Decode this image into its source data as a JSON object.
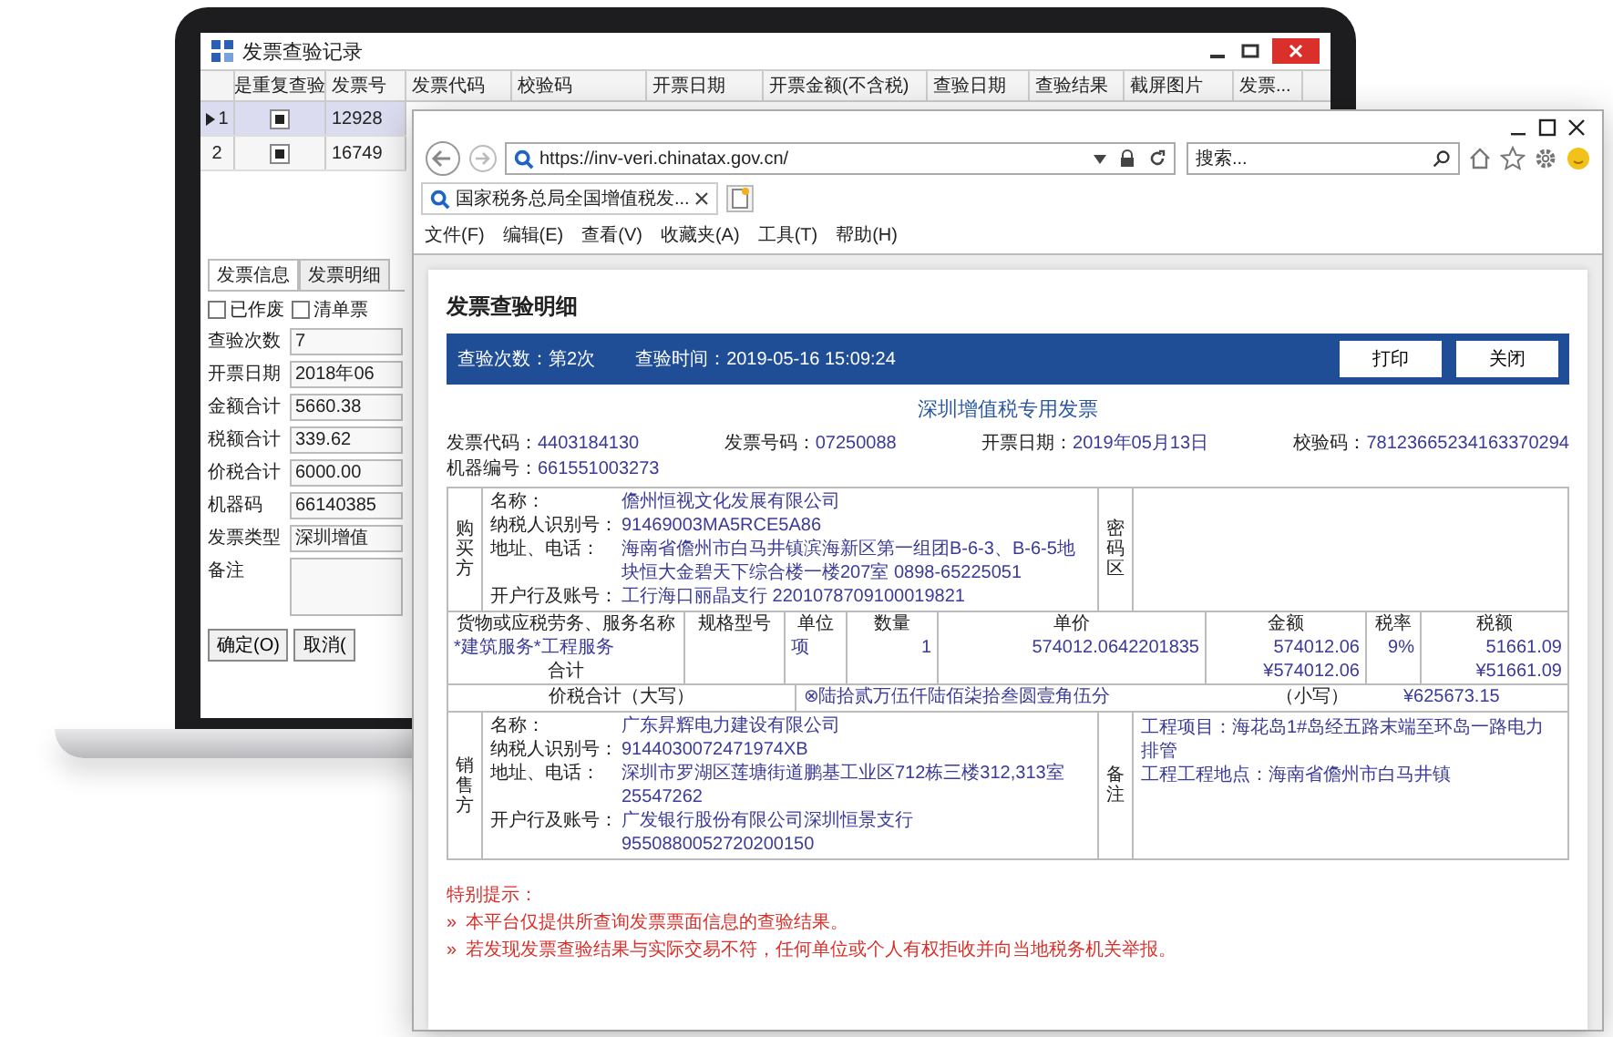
{
  "records_window": {
    "title": "发票查验记录",
    "columns": [
      "是重复查验",
      "发票号",
      "发票代码",
      "校验码",
      "开票日期",
      "开票金额(不含税)",
      "查验日期",
      "查验结果",
      "截屏图片",
      "发票..."
    ],
    "rows": [
      {
        "number": "1",
        "selected": true,
        "repeat_checked": true,
        "invoice_no": "12928"
      },
      {
        "number": "2",
        "selected": false,
        "repeat_checked": true,
        "invoice_no": "16749"
      }
    ],
    "tabs": [
      {
        "label": "发票信息",
        "selected": true
      },
      {
        "label": "发票明细",
        "selected": false
      }
    ],
    "flags": [
      {
        "label": "已作废",
        "checked": false
      },
      {
        "label": "清单票",
        "checked": false
      }
    ],
    "fields": [
      {
        "label": "查验次数",
        "value": "7"
      },
      {
        "label": "开票日期",
        "value": "2018年06"
      },
      {
        "label": "金额合计",
        "value": "5660.38"
      },
      {
        "label": "税额合计",
        "value": "339.62"
      },
      {
        "label": "价税合计",
        "value": "6000.00"
      },
      {
        "label": "机器码",
        "value": "66140385"
      },
      {
        "label": "发票类型",
        "value": "深圳增值"
      }
    ],
    "remark_label": "备注",
    "buttons": [
      "确定(O)",
      "取消("
    ]
  },
  "browser": {
    "address": "https://inv-veri.chinatax.gov.cn/",
    "search_placeholder": "搜索...",
    "tab_title": "国家税务总局全国增值税发...",
    "menu": [
      "文件(F)",
      "编辑(E)",
      "查看(V)",
      "收藏夹(A)",
      "工具(T)",
      "帮助(H)"
    ]
  },
  "result": {
    "heading": "发票查验明细",
    "check_count": "查验次数：第2次",
    "check_time": "查验时间：2019-05-16 15:09:24",
    "buttons": [
      "打印",
      "关闭"
    ],
    "invoice": {
      "title": "深圳增值税专用发票",
      "info": [
        {
          "label": "发票代码：",
          "value": "4403184130"
        },
        {
          "label": "发票号码：",
          "value": "07250088"
        },
        {
          "label": "开票日期：",
          "value": "2019年05月13日"
        },
        {
          "label": "校验码：",
          "value": "78123665234163370294"
        },
        {
          "label": "机器编号：",
          "value": "661551003273"
        }
      ],
      "buyer": {
        "side": "购买方",
        "rows": [
          {
            "label": "名称：",
            "value": "儋州恒视文化发展有限公司"
          },
          {
            "label": "纳税人识别号：",
            "value": "91469003MA5RCE5A86"
          },
          {
            "label": "地址、电话：",
            "value": "海南省儋州市白马井镇滨海新区第一组团B-6-3、B-6-5地块恒大金碧天下综合楼一楼207室 0898-65225051"
          },
          {
            "label": "开户行及账号：",
            "value": "工行海口丽晶支行 2201078709100019821"
          }
        ],
        "area_label": "密码区"
      },
      "goods": {
        "columns": [
          "货物或应税劳务、服务名称",
          "规格型号",
          "单位",
          "数量",
          "单价",
          "金额",
          "税率",
          "税额"
        ],
        "rows": [
          {
            "name": "*建筑服务*工程服务",
            "unit": "项",
            "quantity": "1",
            "price": "574012.0642201835",
            "amount": "574012.06",
            "rate": "9%",
            "tax": "51661.09"
          }
        ],
        "sum_label": "合计",
        "sum_amount": "¥574012.06",
        "sum_tax": "¥51661.09"
      },
      "total": {
        "label": "价税合计（大写）",
        "words": "⊗陆拾贰万伍仟陆佰柒拾叁圆壹角伍分",
        "small_label": "（小写）",
        "figure": "¥625673.15"
      },
      "seller": {
        "side": "销售方",
        "rows": [
          {
            "label": "名称：",
            "value": "广东昇辉电力建设有限公司"
          },
          {
            "label": "纳税人识别号：",
            "value": "9144030072471974XB"
          },
          {
            "label": "地址、电话：",
            "value": "深圳市罗湖区莲塘街道鹏基工业区712栋三楼312,313室 25547262"
          },
          {
            "label": "开户行及账号：",
            "value": "广发银行股份有限公司深圳恒景支行9550880052720200150"
          }
        ],
        "area_label": "备注",
        "remarks": [
          "工程项目：海花岛1#岛经五路末端至环岛一路电力排管",
          "工程工程地点：海南省儋州市白马井镇"
        ]
      }
    },
    "notice": {
      "title": "特别提示：",
      "items": [
        {
          "marker": "»",
          "text": "本平台仅提供所查询发票票面信息的查验结果。"
        },
        {
          "marker": "»",
          "text": "若发现发票查验结果与实际交易不符，任何单位或个人有权拒收并向当地税务机关举报。"
        }
      ]
    }
  }
}
